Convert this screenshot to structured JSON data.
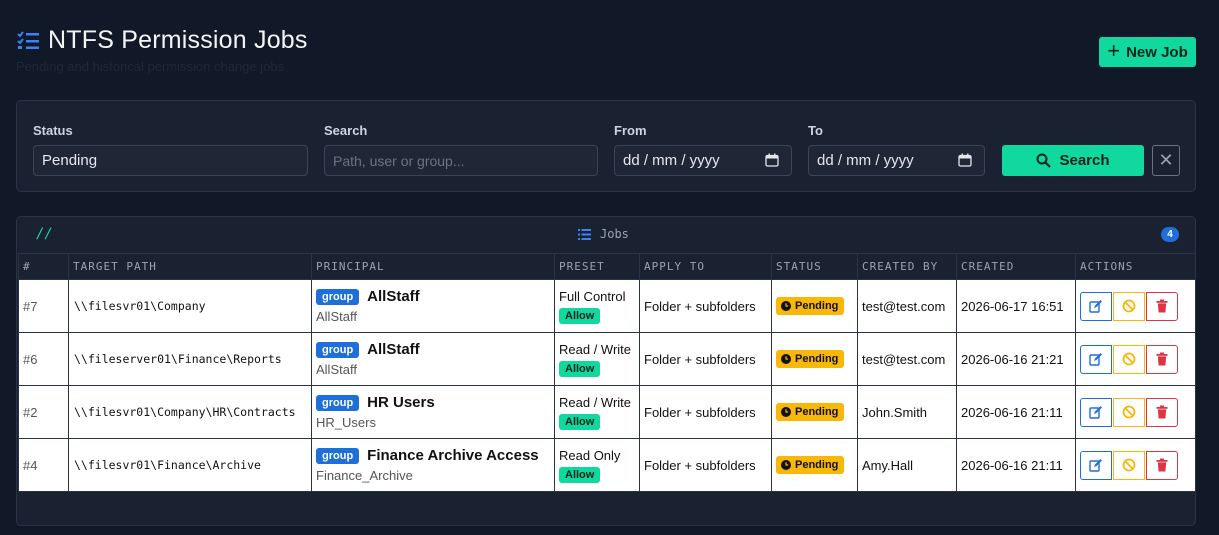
{
  "header": {
    "title": "NTFS Permission Jobs",
    "subtitle": "Pending and historical permission change jobs",
    "new_job_label": "New Job"
  },
  "filters": {
    "status_label": "Status",
    "status_value": "Pending",
    "search_label": "Search",
    "search_placeholder": "Path, user or group...",
    "from_label": "From",
    "from_value": "dd / mm / yyyy",
    "to_label": "To",
    "to_value": "dd / mm / yyyy",
    "search_button": "Search"
  },
  "jobs": {
    "prefix": "//",
    "title": "Jobs",
    "count": "4",
    "columns": [
      "#",
      "TARGET PATH",
      "PRINCIPAL",
      "PRESET",
      "APPLY TO",
      "STATUS",
      "CREATED BY",
      "CREATED",
      "ACTIONS"
    ],
    "rows": [
      {
        "id": "#7",
        "path": "\\\\filesvr01\\Company",
        "principal_type": "group",
        "principal_name": "AllStaff",
        "principal_sub": "AllStaff",
        "preset": "Full Control",
        "preset_type": "Allow",
        "apply_to": "Folder + subfolders",
        "status": "Pending",
        "created_by": "test@test.com",
        "created": "2026-06-17 16:51"
      },
      {
        "id": "#6",
        "path": "\\\\fileserver01\\Finance\\Reports",
        "principal_type": "group",
        "principal_name": "AllStaff",
        "principal_sub": "AllStaff",
        "preset": "Read / Write",
        "preset_type": "Allow",
        "apply_to": "Folder + subfolders",
        "status": "Pending",
        "created_by": "test@test.com",
        "created": "2026-06-16 21:21"
      },
      {
        "id": "#2",
        "path": "\\\\filesvr01\\Company\\HR\\Contracts",
        "principal_type": "group",
        "principal_name": "HR Users",
        "principal_sub": "HR_Users",
        "preset": "Read / Write",
        "preset_type": "Allow",
        "apply_to": "Folder + subfolders",
        "status": "Pending",
        "created_by": "John.Smith",
        "created": "2026-06-16 21:11"
      },
      {
        "id": "#4",
        "path": "\\\\filesvr01\\Finance\\Archive",
        "principal_type": "group",
        "principal_name": "Finance Archive Access",
        "principal_sub": "Finance_Archive",
        "preset": "Read Only",
        "preset_type": "Allow",
        "apply_to": "Folder + subfolders",
        "status": "Pending",
        "created_by": "Amy.Hall",
        "created": "2026-06-16 21:11"
      }
    ]
  },
  "colors": {
    "accent": "#10d89e",
    "primary": "#1e6fd9",
    "warning": "#f7b80a",
    "danger": "#dc3545",
    "background": "#111827"
  },
  "icons": {
    "title": "list-check-icon",
    "new_job": "plus-icon",
    "calendar": "calendar-icon",
    "search": "search-icon",
    "clear": "close-icon",
    "edit": "edit-icon",
    "cancel": "ban-icon",
    "delete": "trash-icon"
  }
}
